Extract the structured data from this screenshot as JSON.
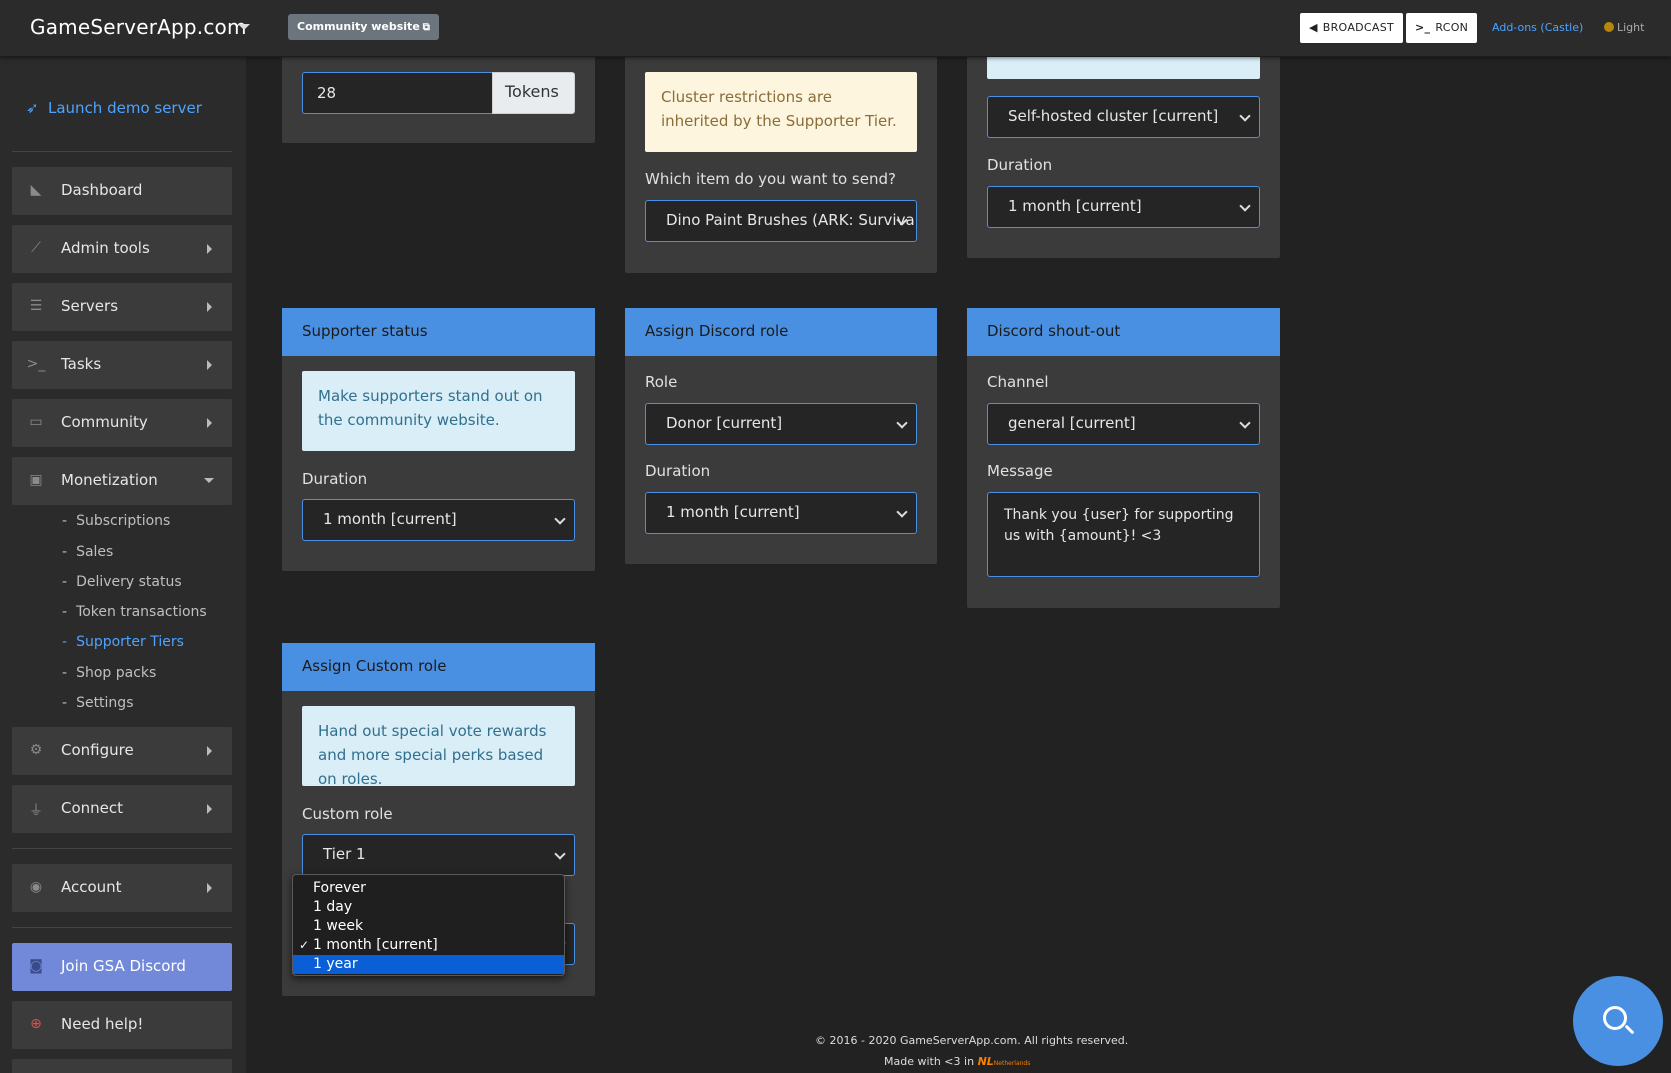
{
  "topbar": {
    "brand": "GameServerApp.com",
    "community_btn": "Community website",
    "broadcast_label": "BROADCAST",
    "rcon_label": "RCON",
    "addons_label": "Add-ons (Castle)",
    "theme_label": "Light"
  },
  "sidebar": {
    "launch": "Launch demo server",
    "items": {
      "dashboard": "Dashboard",
      "admin_tools": "Admin tools",
      "servers": "Servers",
      "tasks": "Tasks",
      "community": "Community",
      "monetization": "Monetization",
      "configure": "Configure",
      "connect": "Connect",
      "account": "Account",
      "join_discord": "Join GSA Discord",
      "need_help": "Need help!"
    },
    "monetization_sub": {
      "subscriptions": "Subscriptions",
      "sales": "Sales",
      "delivery_status": "Delivery status",
      "token_transactions": "Token transactions",
      "supporter_tiers": "Supporter Tiers",
      "shop_packs": "Shop packs",
      "settings": "Settings"
    }
  },
  "cards": {
    "tokens": {
      "value": "28",
      "addon": "Tokens"
    },
    "items": {
      "warning": "Cluster restrictions are inherited by the Supporter Tier.",
      "question": "Which item do you want to send?",
      "selected": "Dino Paint Brushes (ARK: Survival"
    },
    "cluster": {
      "selected": "Self-hosted cluster [current]",
      "duration_label": "Duration",
      "duration": "1 month [current]"
    },
    "supporter_status": {
      "title": "Supporter status",
      "info": "Make supporters stand out on the community website.",
      "duration_label": "Duration",
      "duration": "1 month [current]"
    },
    "discord_role": {
      "title": "Assign Discord role",
      "role_label": "Role",
      "role": "Donor [current]",
      "duration_label": "Duration",
      "duration": "1 month [current]"
    },
    "discord_shoutout": {
      "title": "Discord shout-out",
      "channel_label": "Channel",
      "channel": "general [current]",
      "message_label": "Message",
      "message": "Thank you {user} for supporting us with {amount}! <3"
    },
    "custom_role": {
      "title": "Assign Custom role",
      "info": "Hand out special vote rewards and more special perks based on roles.",
      "role_label": "Custom role",
      "role": "Tier 1"
    }
  },
  "dropdown": {
    "options": [
      "Forever",
      "1 day",
      "1 week",
      "1 month [current]",
      "1 year"
    ],
    "checked_index": 3,
    "highlighted_index": 4
  },
  "footer": {
    "copyright": "© 2016 - 2020 GameServerApp.com. All rights reserved.",
    "made_with": "Made with <3 in",
    "nl": "NL",
    "nl_sub": "Netherlands"
  },
  "colors": {
    "accent": "#4a90e2",
    "link": "#4da3ff",
    "discord": "#7289da",
    "highlight": "#0a5fd6"
  }
}
